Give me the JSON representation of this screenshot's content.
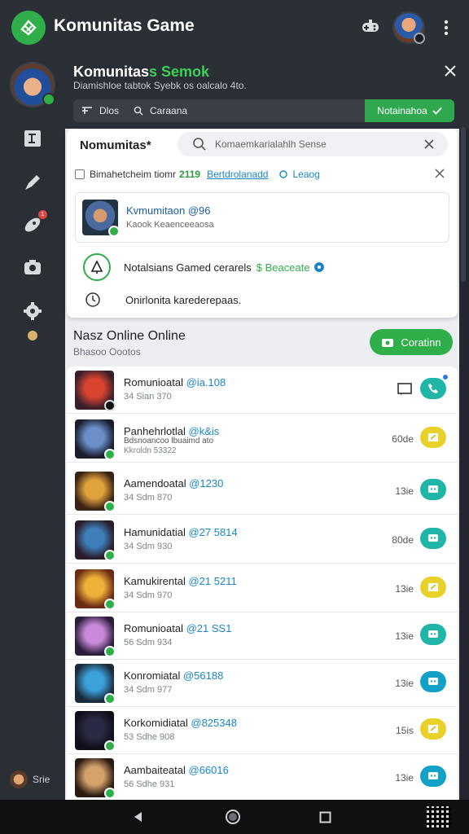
{
  "app_bar": {
    "title": "Komunitas Game",
    "logo_icon": "game-controller-leaf-icon",
    "actions": [
      "gamepad-icon",
      "user-avatar",
      "more-vert-icon"
    ]
  },
  "panel": {
    "title_main": "Komunitas",
    "title_accent": "s Semok",
    "subtitle": "Diamishloe tabtok Syebk os oalcalo 4to.",
    "bar_left_label": "Dlos",
    "bar_left_label2": "Caraana",
    "bar_button": "Notainahoa",
    "colors": {
      "accent": "#2fae4a",
      "dark": "#2a2e35"
    }
  },
  "search_card": {
    "title": "Nomumitas",
    "title_suffix": "*",
    "search_value": "Komaemkarialahlh Sense",
    "filter_prefix": "Bimahetcheim tiomr",
    "filter_num": "2119",
    "filter_link": "Bertdrolanadd",
    "filter_tag": "Leaog",
    "result_title": "Kvmumitaon @96",
    "result_sub": "Kaook Keaenceeaosa",
    "notif_text": "Notalsians Gamed cerarels",
    "notif_green": "$ Beaceate",
    "online_text": "Onirlonita karederepaas."
  },
  "section": {
    "title": "Nasz Online Online",
    "subtitle": "Bhasoo Oootos",
    "add_button": "Coratinn"
  },
  "members": [
    {
      "name": "Romunioatal",
      "handle": "@ia.108",
      "meta": "34 Sian 370",
      "time": "",
      "action": "teal",
      "avatar_colors": [
        "#d9442f",
        "#3a1f2a"
      ]
    },
    {
      "name": "Panhehrlotlal",
      "handle": "@k&is",
      "meta": "Bdsnoancoo lbuaimd ato",
      "meta_b": "Kkroldn 53322",
      "time": "60de",
      "action": "yellow",
      "avatar_colors": [
        "#6a8fc9",
        "#1a1c2c"
      ]
    },
    {
      "name": "Aamendoatal",
      "handle": "@1230",
      "meta": "34 Sdm 870",
      "time": "13ie",
      "action": "teal",
      "avatar_colors": [
        "#e2a23c",
        "#3a2214"
      ]
    },
    {
      "name": "Hamunidatial",
      "handle": "@27 5814",
      "meta": "34 Sdm 930",
      "time": "80de",
      "action": "teal",
      "avatar_colors": [
        "#3e7fb9",
        "#2a1c2a"
      ]
    },
    {
      "name": "Kamukirental",
      "handle": "@21 5211",
      "meta": "34 Sdm 970",
      "time": "13ie",
      "action": "yellow",
      "avatar_colors": [
        "#f0b13a",
        "#6a2a14"
      ]
    },
    {
      "name": "Romunioatal",
      "handle": "@21 SS1",
      "meta": "56 Sdm 934",
      "time": "13ie",
      "action": "teal",
      "avatar_colors": [
        "#c98ad9",
        "#2a1c3a"
      ]
    },
    {
      "name": "Konromiatal",
      "handle": "@56188",
      "meta": "34 Sdm 977",
      "time": "13ie",
      "action": "blue",
      "avatar_colors": [
        "#3ca0d9",
        "#1a2a3a"
      ]
    },
    {
      "name": "Korkomidiatal",
      "handle": "@825348",
      "meta": "53 Sdhe 908",
      "time": "15is",
      "action": "yellow",
      "avatar_colors": [
        "#2a2a44",
        "#0f0f1a"
      ]
    },
    {
      "name": "Aambaiteatal",
      "handle": "@66016",
      "meta": "56 Sdhe 931",
      "time": "13ie",
      "action": "blue",
      "avatar_colors": [
        "#d6a26c",
        "#2a1a12"
      ]
    }
  ],
  "rail": {
    "bottom_user_label": "Srie",
    "items": [
      "leaderboard-icon",
      "edit-brush-icon",
      "rocket-icon",
      "camera-icon",
      "settings-gear-icon"
    ]
  },
  "system_nav": [
    "back-icon",
    "home-icon",
    "recent-apps-icon",
    "qr-code-icon"
  ]
}
